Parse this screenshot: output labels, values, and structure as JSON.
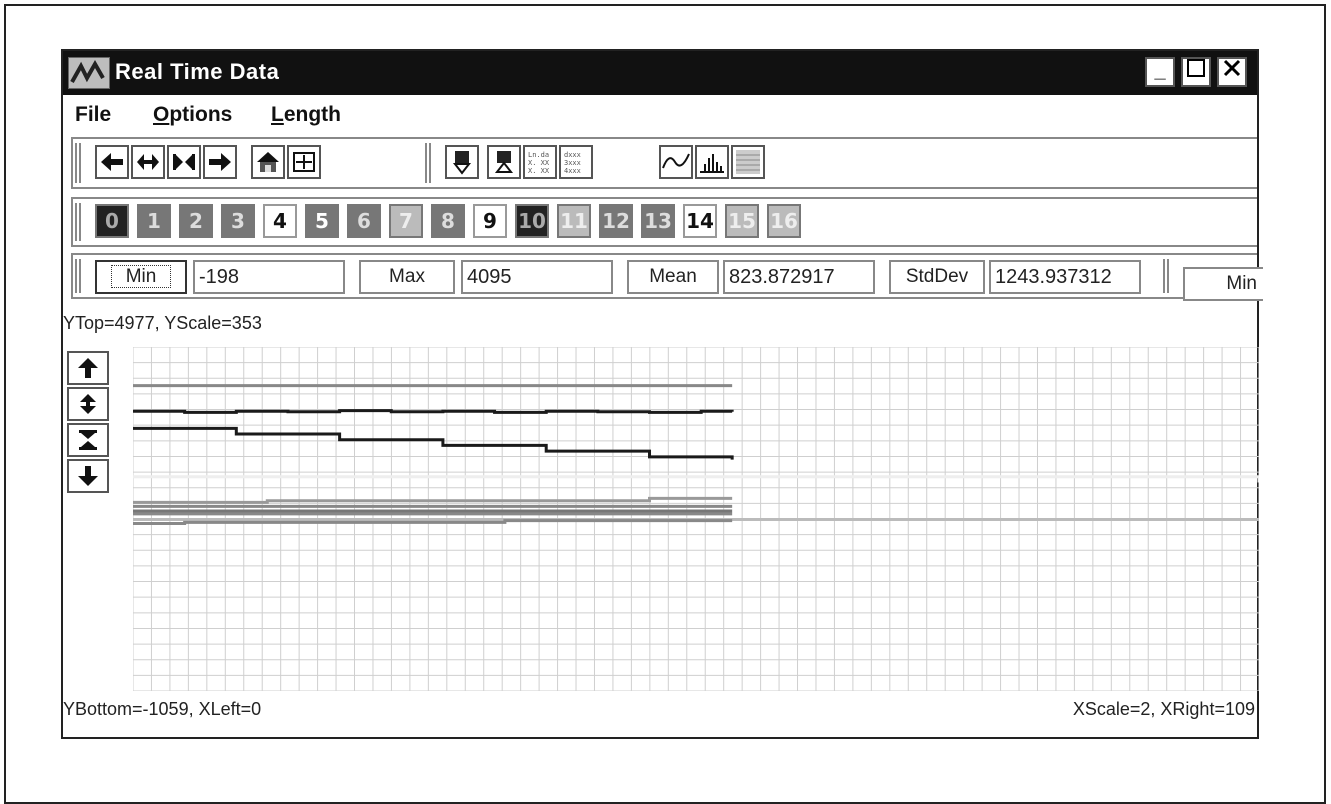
{
  "window": {
    "title": "Real Time Data",
    "controls": {
      "minimize": "_",
      "maximize": "☐",
      "close": "✕"
    }
  },
  "menu": {
    "items": [
      {
        "label": "File",
        "accel": ""
      },
      {
        "label": "ptions",
        "accel": "O"
      },
      {
        "label": "ength",
        "accel": "L"
      }
    ]
  },
  "toolbar1": {
    "icons": [
      "left-arrow-icon",
      "expand-horizontal-icon",
      "compress-horizontal-icon",
      "right-arrow-icon",
      "home-icon",
      "fit-all-icon",
      "download-icon",
      "upload-icon",
      "table-icon",
      "hex-table-icon",
      "waveform-icon",
      "histogram-icon",
      "grid-data-icon"
    ],
    "table_labels": [
      "Ln.da",
      "X. XX",
      "X. XX"
    ],
    "hex_labels": [
      "dxxx",
      "3xxx",
      "4xxx"
    ]
  },
  "channels": {
    "labels": [
      "0",
      "1",
      "2",
      "3",
      "4",
      "5",
      "6",
      "7",
      "8",
      "9",
      "10",
      "11",
      "12",
      "13",
      "14",
      "15",
      "16"
    ],
    "styles": [
      "dark",
      "mid",
      "mid",
      "mid",
      "white",
      "midwhite",
      "mid",
      "light",
      "mid",
      "white",
      "dark",
      "light",
      "mid",
      "mid",
      "white",
      "light",
      "light"
    ]
  },
  "stats": {
    "min_label": "Min",
    "min_value": "-198",
    "max_label": "Max",
    "max_value": "4095",
    "mean_label": "Mean",
    "mean_value": "823.872917",
    "stddev_label": "StdDev",
    "stddev_value": "1243.937312",
    "min2_label": "Min"
  },
  "status": {
    "top": "YTop=4977, YScale=353",
    "bottom_left": "YBottom=-1059, XLeft=0",
    "bottom_right": "XScale=2, XRight=109"
  },
  "vertical_controls": [
    "up-arrow-icon",
    "expand-vertical-icon",
    "compress-vertical-icon",
    "down-arrow-icon"
  ],
  "colors": {
    "titlebar": "#111111",
    "grid": "#cfcfcf",
    "trace_dark": "#1a1a1a",
    "trace_gray": "#888888",
    "trace_light": "#bbbbbb"
  },
  "chart_data": {
    "type": "line",
    "x_range": [
      0,
      109
    ],
    "y_range": [
      -1059,
      4977
    ],
    "grid": true,
    "series": [
      {
        "x": [
          0,
          58
        ],
        "y": [
          4300,
          4300
        ],
        "color": "#888888"
      },
      {
        "x": [
          0,
          5,
          10,
          15,
          20,
          25,
          30,
          35,
          40,
          45,
          50,
          55,
          58
        ],
        "y": [
          3850,
          3830,
          3850,
          3840,
          3860,
          3840,
          3850,
          3830,
          3850,
          3840,
          3830,
          3850,
          3840
        ],
        "color": "#1a1a1a"
      },
      {
        "x": [
          0,
          10,
          20,
          30,
          40,
          50,
          58
        ],
        "y": [
          3550,
          3450,
          3350,
          3250,
          3150,
          3050,
          3000
        ],
        "color": "#1a1a1a"
      },
      {
        "x": [
          0,
          109
        ],
        "y": [
          2700,
          2600
        ],
        "color": "#eeeeee"
      },
      {
        "x": [
          0,
          12,
          13,
          49,
          50,
          58
        ],
        "y": [
          2250,
          2250,
          2280,
          2280,
          2320,
          2320
        ],
        "color": "#999999"
      },
      {
        "x": [
          0,
          58
        ],
        "y": [
          2180,
          2180
        ],
        "color": "#888888"
      },
      {
        "x": [
          0,
          58
        ],
        "y": [
          2100,
          2100
        ],
        "color": "#777777"
      },
      {
        "x": [
          0,
          58
        ],
        "y": [
          2050,
          2050
        ],
        "color": "#888888"
      },
      {
        "x": [
          0,
          109
        ],
        "y": [
          1950,
          1950
        ],
        "color": "#bbbbbb"
      },
      {
        "x": [
          0,
          4,
          5,
          35,
          36,
          58
        ],
        "y": [
          1880,
          1880,
          1900,
          1900,
          1930,
          1930
        ],
        "color": "#888888"
      }
    ]
  }
}
